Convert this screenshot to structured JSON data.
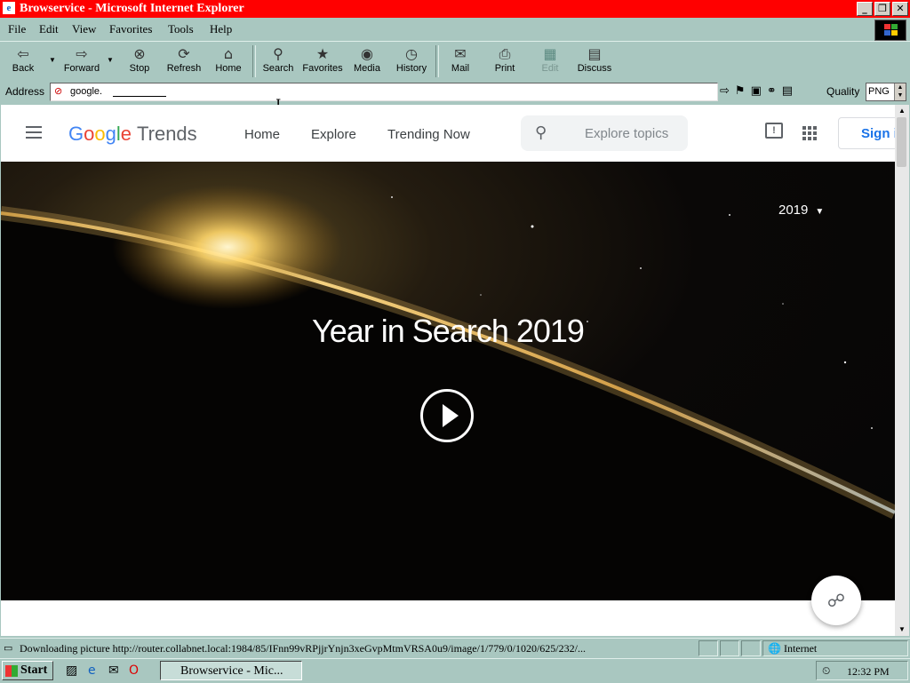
{
  "window": {
    "title": "Browservice - Microsoft Internet Explorer",
    "min": "_",
    "restore": "❐",
    "close": "✕"
  },
  "menu": [
    "File",
    "Edit",
    "View",
    "Favorites",
    "Tools",
    "Help"
  ],
  "toolbar": {
    "back": "Back",
    "forward": "Forward",
    "stop": "Stop",
    "refresh": "Refresh",
    "home": "Home",
    "search": "Search",
    "favorites": "Favorites",
    "media": "Media",
    "history": "History",
    "mail": "Mail",
    "print": "Print",
    "edit": "Edit",
    "discuss": "Discuss"
  },
  "address": {
    "label": "Address",
    "value": "google.",
    "quality_label": "Quality",
    "quality_value": "PNG"
  },
  "page": {
    "logo_google": [
      "G",
      "o",
      "o",
      "g",
      "l",
      "e"
    ],
    "logo_trends": "Trends",
    "nav": [
      "Home",
      "Explore",
      "Trending Now"
    ],
    "search_placeholder": "Explore topics",
    "sign_in": "Sign in",
    "year": "2019",
    "hero_title": "Year in Search 2019"
  },
  "status": {
    "text": "Downloading picture http://router.collabnet.local:1984/85/IFnn99vRPjjrYnjn3xeGvpMtmVRSA0u9/image/1/779/0/1020/625/232/...",
    "zone": "Internet"
  },
  "taskbar": {
    "start": "Start",
    "task": "Browservice - Mic...",
    "clock": "12:32 PM"
  },
  "icons": {
    "back": "⇦",
    "forward": "⇨",
    "stop": "⊗",
    "refresh": "⟳",
    "home": "⌂",
    "search": "🔍",
    "favorites": "★",
    "media": "◉",
    "history": "◷",
    "mail": "✉",
    "print": "⎙",
    "edit": "▦",
    "discuss": "▤",
    "search_glass": "⚲",
    "share": "⋖",
    "go": "⇨"
  },
  "colors": {
    "titlebar": "#ff0000",
    "chrome": "#a9c7c0",
    "signin": "#1a73e8"
  }
}
